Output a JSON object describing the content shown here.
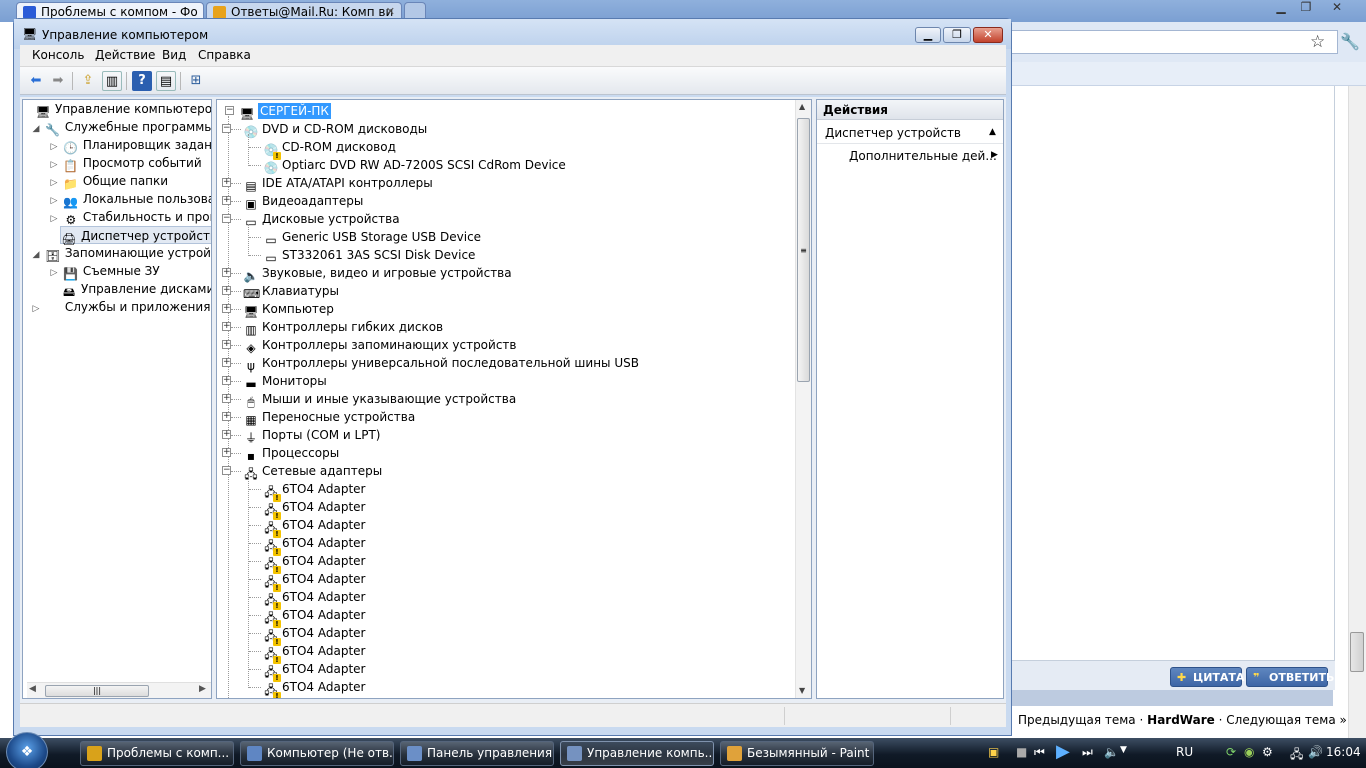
{
  "browser": {
    "tabs": [
      {
        "label": "Проблемы с компом - Фо",
        "favicon_color": "#2a5bd7"
      },
      {
        "label": "Ответы@Mail.Ru: Комп ви",
        "favicon_color": "#e8a21a"
      }
    ],
    "reply_buttons": {
      "quote": "ЦИТАТА",
      "reply": "ОТВЕТИТЬ"
    },
    "thread_nav": {
      "prev": "Предыдущая тема",
      "sep": "·",
      "current": "HardWare",
      "next": "Следующая тема »"
    }
  },
  "mmc": {
    "title": "Управление компьютером",
    "menu": [
      "Консоль",
      "Действие",
      "Вид",
      "Справка"
    ],
    "left_tree": [
      {
        "label": "Управление компьютером (л",
        "level": 0,
        "toggle": "",
        "icon": "computer-management-icon",
        "glyph": "🖥"
      },
      {
        "label": "Служебные программы",
        "level": 1,
        "toggle": "◢",
        "icon": "tools-icon",
        "glyph": "🔧"
      },
      {
        "label": "Планировщик заданий",
        "level": 2,
        "toggle": "▷",
        "icon": "clock-icon",
        "glyph": "🕒"
      },
      {
        "label": "Просмотр событий",
        "level": 2,
        "toggle": "▷",
        "icon": "event-viewer-icon",
        "glyph": "📋"
      },
      {
        "label": "Общие папки",
        "level": 2,
        "toggle": "▷",
        "icon": "shared-folder-icon",
        "glyph": "📁"
      },
      {
        "label": "Локальные пользовате",
        "level": 2,
        "toggle": "▷",
        "icon": "users-icon",
        "glyph": "👥"
      },
      {
        "label": "Стабильность и произ",
        "level": 2,
        "toggle": "▷",
        "icon": "performance-icon",
        "glyph": "⚙"
      },
      {
        "label": "Диспетчер устройств",
        "level": 2,
        "toggle": "",
        "icon": "device-manager-icon",
        "glyph": "🖨",
        "selected": true
      },
      {
        "label": "Запоминающие устройст",
        "level": 1,
        "toggle": "◢",
        "icon": "storage-icon",
        "glyph": "🗄"
      },
      {
        "label": "Съемные ЗУ",
        "level": 2,
        "toggle": "▷",
        "icon": "removable-storage-icon",
        "glyph": "💾"
      },
      {
        "label": "Управление дисками",
        "level": 2,
        "toggle": "",
        "icon": "disk-management-icon",
        "glyph": "🖴"
      },
      {
        "label": "Службы и приложения",
        "level": 1,
        "toggle": "▷",
        "icon": "services-icon",
        "glyph": ""
      }
    ],
    "device_tree": {
      "root": "СЕРГЕЙ-ПК",
      "nodes": [
        {
          "label": "DVD и CD-ROM дисководы",
          "level": 1,
          "expanded": true,
          "icon": "dvd-drive-icon",
          "glyph": "💿"
        },
        {
          "label": "CD-ROM дисковод",
          "level": 2,
          "icon": "cdrom-warning-icon",
          "glyph": "💿",
          "warn": true
        },
        {
          "label": "Optiarc DVD RW AD-7200S SCSI CdRom Device",
          "level": 2,
          "icon": "dvd-device-icon",
          "glyph": "💿"
        },
        {
          "label": "IDE ATA/ATAPI контроллеры",
          "level": 1,
          "expanded": false,
          "icon": "ide-controller-icon",
          "glyph": "▤"
        },
        {
          "label": "Видеоадаптеры",
          "level": 1,
          "expanded": false,
          "icon": "display-adapter-icon",
          "glyph": "▣"
        },
        {
          "label": "Дисковые устройства",
          "level": 1,
          "expanded": true,
          "icon": "disk-drive-icon",
          "glyph": "▭"
        },
        {
          "label": "Generic USB Storage USB Device",
          "level": 2,
          "icon": "usb-disk-icon",
          "glyph": "▭"
        },
        {
          "label": "ST332061 3AS SCSI Disk Device",
          "level": 2,
          "icon": "hdd-icon",
          "glyph": "▭"
        },
        {
          "label": "Звуковые, видео и игровые устройства",
          "level": 1,
          "expanded": false,
          "icon": "speaker-icon",
          "glyph": "🔈"
        },
        {
          "label": "Клавиатуры",
          "level": 1,
          "expanded": false,
          "icon": "keyboard-icon",
          "glyph": "⌨"
        },
        {
          "label": "Компьютер",
          "level": 1,
          "expanded": false,
          "icon": "computer-icon",
          "glyph": "🖥"
        },
        {
          "label": "Контроллеры гибких дисков",
          "level": 1,
          "expanded": false,
          "icon": "floppy-controller-icon",
          "glyph": "▥"
        },
        {
          "label": "Контроллеры запоминающих устройств",
          "level": 1,
          "expanded": false,
          "icon": "storage-controller-icon",
          "glyph": "◈"
        },
        {
          "label": "Контроллеры универсальной последовательной шины USB",
          "level": 1,
          "expanded": false,
          "icon": "usb-icon",
          "glyph": "ψ"
        },
        {
          "label": "Мониторы",
          "level": 1,
          "expanded": false,
          "icon": "monitor-icon",
          "glyph": "▬"
        },
        {
          "label": "Мыши и иные указывающие устройства",
          "level": 1,
          "expanded": false,
          "icon": "mouse-icon",
          "glyph": "🖱"
        },
        {
          "label": "Переносные устройства",
          "level": 1,
          "expanded": false,
          "icon": "portable-device-icon",
          "glyph": "▦"
        },
        {
          "label": "Порты (COM и LPT)",
          "level": 1,
          "expanded": false,
          "icon": "port-icon",
          "glyph": "⏚"
        },
        {
          "label": "Процессоры",
          "level": 1,
          "expanded": false,
          "icon": "processor-icon",
          "glyph": "▪"
        },
        {
          "label": "Сетевые адаптеры",
          "level": 1,
          "expanded": true,
          "icon": "network-adapter-icon",
          "glyph": "🖧"
        },
        {
          "label": "6TO4 Adapter",
          "level": 2,
          "icon": "network-warning-icon",
          "glyph": "🖧",
          "warn": true
        },
        {
          "label": "6TO4 Adapter",
          "level": 2,
          "icon": "network-warning-icon",
          "glyph": "🖧",
          "warn": true
        },
        {
          "label": "6TO4 Adapter",
          "level": 2,
          "icon": "network-warning-icon",
          "glyph": "🖧",
          "warn": true
        },
        {
          "label": "6TO4 Adapter",
          "level": 2,
          "icon": "network-warning-icon",
          "glyph": "🖧",
          "warn": true
        },
        {
          "label": "6TO4 Adapter",
          "level": 2,
          "icon": "network-warning-icon",
          "glyph": "🖧",
          "warn": true
        },
        {
          "label": "6TO4 Adapter",
          "level": 2,
          "icon": "network-warning-icon",
          "glyph": "🖧",
          "warn": true
        },
        {
          "label": "6TO4 Adapter",
          "level": 2,
          "icon": "network-warning-icon",
          "glyph": "🖧",
          "warn": true
        },
        {
          "label": "6TO4 Adapter",
          "level": 2,
          "icon": "network-warning-icon",
          "glyph": "🖧",
          "warn": true
        },
        {
          "label": "6TO4 Adapter",
          "level": 2,
          "icon": "network-warning-icon",
          "glyph": "🖧",
          "warn": true
        },
        {
          "label": "6TO4 Adapter",
          "level": 2,
          "icon": "network-warning-icon",
          "glyph": "🖧",
          "warn": true
        },
        {
          "label": "6TO4 Adapter",
          "level": 2,
          "icon": "network-warning-icon",
          "glyph": "🖧",
          "warn": true
        },
        {
          "label": "6TO4 Adapter",
          "level": 2,
          "icon": "network-warning-icon",
          "glyph": "🖧",
          "warn": true
        }
      ]
    },
    "actions": {
      "header": "Действия",
      "section": "Диспетчер устройств",
      "item": "Дополнительные дей..."
    }
  },
  "taskbar": {
    "tasks": [
      {
        "label": "Проблемы с комп...",
        "icon": "chrome-icon",
        "color": "#d9a21a"
      },
      {
        "label": "Компьютер (Не отв...",
        "icon": "computer-icon",
        "color": "#5f86c3"
      },
      {
        "label": "Панель управления",
        "icon": "control-panel-icon",
        "color": "#6b8fc7"
      },
      {
        "label": "Управление компь...",
        "icon": "computer-management-icon",
        "color": "#7592c0",
        "active": true
      },
      {
        "label": "Безымянный - Paint",
        "icon": "paint-icon",
        "color": "#e0a23a"
      }
    ],
    "lang": "RU",
    "clock": "16:04"
  },
  "colors": {
    "accent": "#3399ff",
    "selection": "#3399ff",
    "warning": "#f5c400"
  }
}
